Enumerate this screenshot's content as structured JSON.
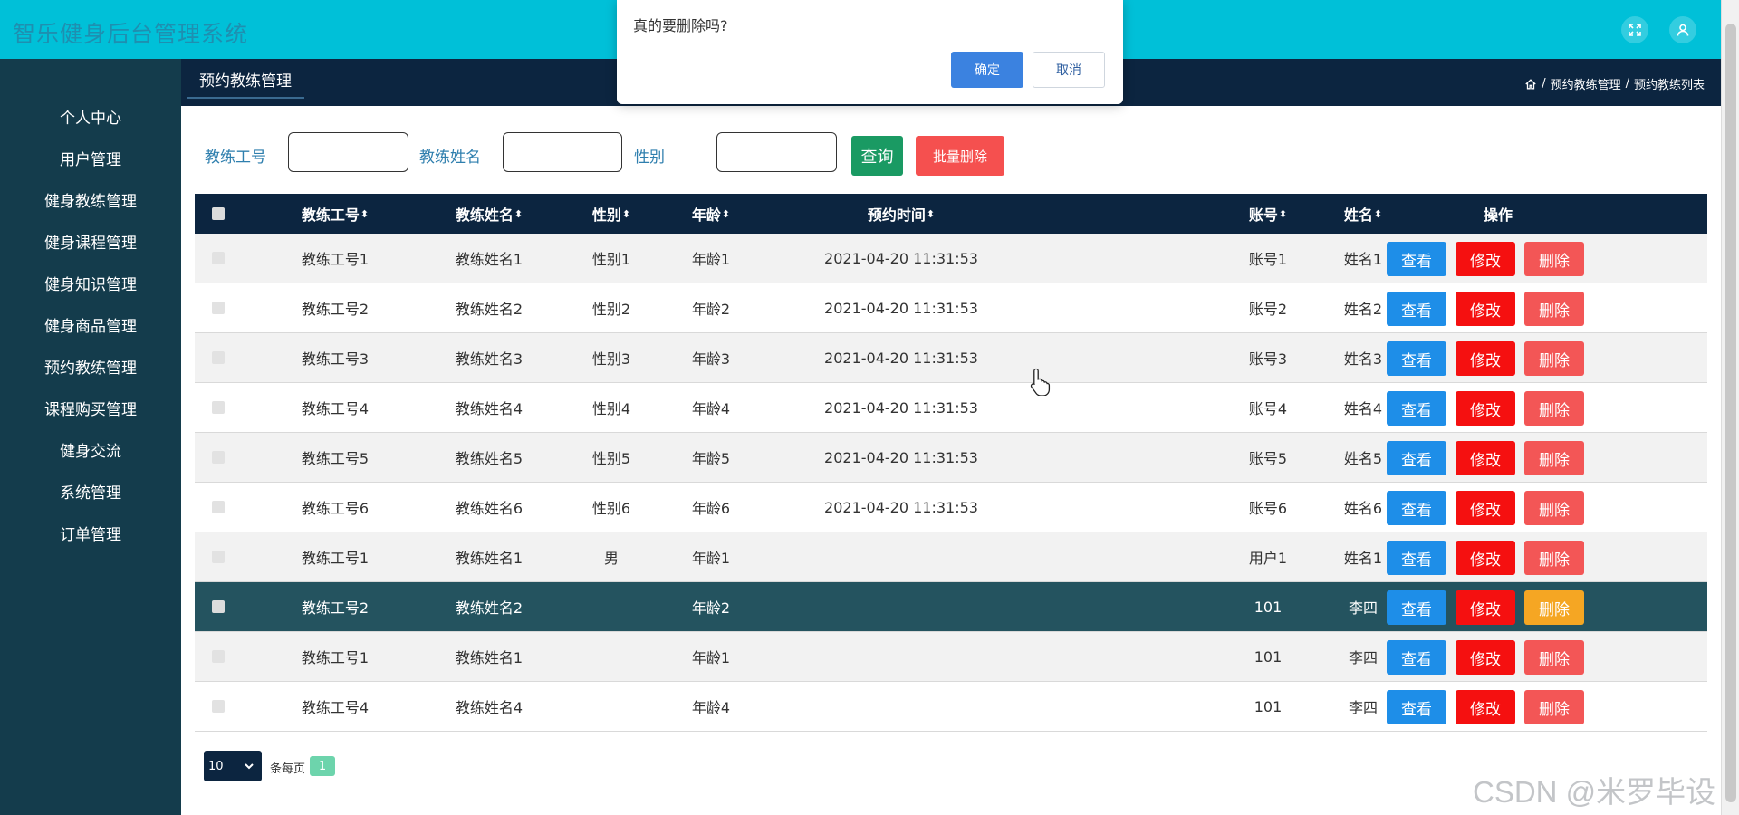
{
  "header": {
    "title": "智乐健身后台管理系统",
    "icons": [
      "fullscreen-icon",
      "user-icon"
    ]
  },
  "sidebar": {
    "items": [
      {
        "label": "个人中心"
      },
      {
        "label": "用户管理"
      },
      {
        "label": "健身教练管理"
      },
      {
        "label": "健身课程管理"
      },
      {
        "label": "健身知识管理"
      },
      {
        "label": "健身商品管理"
      },
      {
        "label": "预约教练管理"
      },
      {
        "label": "课程购买管理"
      },
      {
        "label": "健身交流"
      },
      {
        "label": "系统管理"
      },
      {
        "label": "订单管理"
      }
    ]
  },
  "tabs": [
    {
      "label": "预约教练管理"
    }
  ],
  "breadcrumb": {
    "items": [
      "预约教练管理",
      "预约教练列表"
    ]
  },
  "search": {
    "coach_no_label": "教练工号",
    "coach_name_label": "教练姓名",
    "gender_label": "性别",
    "coach_no_value": "",
    "coach_name_value": "",
    "gender_value": "",
    "query_label": "查询",
    "batch_delete_label": "批量删除"
  },
  "table": {
    "headers": {
      "coach_no": "教练工号",
      "coach_name": "教练姓名",
      "gender": "性别",
      "age": "年龄",
      "time": "预约时间",
      "account": "账号",
      "name": "姓名",
      "actions": "操作"
    },
    "sort_glyph": "⬍",
    "actions": {
      "view": "查看",
      "edit": "修改",
      "delete": "删除"
    },
    "rows": [
      {
        "coach_no": "教练工号1",
        "coach_name": "教练姓名1",
        "gender": "性别1",
        "age": "年龄1",
        "time": "2021-04-20 11:31:53",
        "account": "账号1",
        "name": "姓名1"
      },
      {
        "coach_no": "教练工号2",
        "coach_name": "教练姓名2",
        "gender": "性别2",
        "age": "年龄2",
        "time": "2021-04-20 11:31:53",
        "account": "账号2",
        "name": "姓名2"
      },
      {
        "coach_no": "教练工号3",
        "coach_name": "教练姓名3",
        "gender": "性别3",
        "age": "年龄3",
        "time": "2021-04-20 11:31:53",
        "account": "账号3",
        "name": "姓名3"
      },
      {
        "coach_no": "教练工号4",
        "coach_name": "教练姓名4",
        "gender": "性别4",
        "age": "年龄4",
        "time": "2021-04-20 11:31:53",
        "account": "账号4",
        "name": "姓名4"
      },
      {
        "coach_no": "教练工号5",
        "coach_name": "教练姓名5",
        "gender": "性别5",
        "age": "年龄5",
        "time": "2021-04-20 11:31:53",
        "account": "账号5",
        "name": "姓名5"
      },
      {
        "coach_no": "教练工号6",
        "coach_name": "教练姓名6",
        "gender": "性别6",
        "age": "年龄6",
        "time": "2021-04-20 11:31:53",
        "account": "账号6",
        "name": "姓名6"
      },
      {
        "coach_no": "教练工号1",
        "coach_name": "教练姓名1",
        "gender": "男",
        "age": "年龄1",
        "time": "",
        "account": "用户1",
        "name": "姓名1"
      },
      {
        "coach_no": "教练工号2",
        "coach_name": "教练姓名2",
        "gender": "",
        "age": "年龄2",
        "time": "",
        "account": "101",
        "name": "李四",
        "highlighted": true
      },
      {
        "coach_no": "教练工号1",
        "coach_name": "教练姓名1",
        "gender": "",
        "age": "年龄1",
        "time": "",
        "account": "101",
        "name": "李四"
      },
      {
        "coach_no": "教练工号4",
        "coach_name": "教练姓名4",
        "gender": "",
        "age": "年龄4",
        "time": "",
        "account": "101",
        "name": "李四"
      }
    ]
  },
  "pagination": {
    "page_size": "10",
    "per_page_label": "条每页",
    "current_page": "1"
  },
  "dialog": {
    "message": "真的要删除吗?",
    "ok_label": "确定",
    "cancel_label": "取消"
  },
  "watermark": "CSDN @米罗毕设",
  "colors": {
    "header_bg": "#00c0d8",
    "sidebar_bg": "#143c4c",
    "nav_bg": "#0c2540",
    "highlight_row": "#24535f",
    "view_btn": "#1e8ee8",
    "edit_btn": "#f51010",
    "delete_btn": "#f35656",
    "delete_btn_active": "#f5a623"
  }
}
